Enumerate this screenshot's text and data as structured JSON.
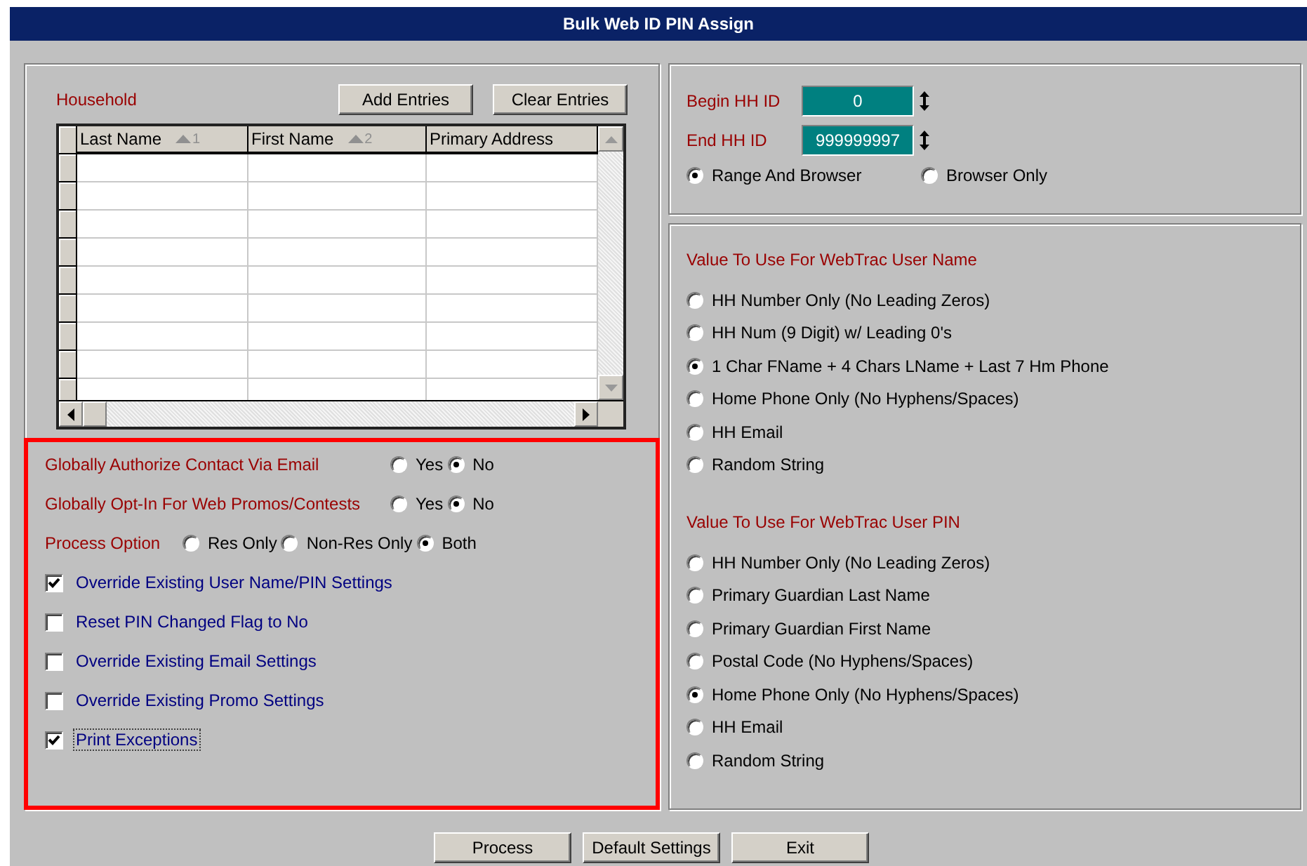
{
  "window": {
    "title": "Bulk Web ID PIN Assign"
  },
  "household": {
    "label": "Household",
    "buttons": [
      "Add Entries",
      "Clear Entries"
    ],
    "columns": [
      {
        "label": "Last Name",
        "sort_order": "1"
      },
      {
        "label": "First Name",
        "sort_order": "2"
      },
      {
        "label": "Primary Address"
      }
    ]
  },
  "options": [
    {
      "kind": "radio_group",
      "label": "Globally Authorize Contact Via Email",
      "choices": [
        {
          "label": "Yes",
          "selected": false
        },
        {
          "label": "No",
          "selected": true
        }
      ]
    },
    {
      "kind": "radio_group",
      "label": "Globally Opt-In For Web Promos/Contests",
      "choices": [
        {
          "label": "Yes",
          "selected": false
        },
        {
          "label": "No",
          "selected": true
        }
      ]
    },
    {
      "kind": "radio_group",
      "label": "Process Option",
      "choices": [
        {
          "label": "Res Only",
          "selected": false
        },
        {
          "label": "Non-Res Only",
          "selected": false
        },
        {
          "label": "Both",
          "selected": true
        }
      ]
    },
    {
      "kind": "checkbox",
      "label": "Override Existing User Name/PIN Settings",
      "checked": true,
      "focused": false
    },
    {
      "kind": "checkbox",
      "label": "Reset PIN Changed Flag to No",
      "checked": false,
      "focused": false
    },
    {
      "kind": "checkbox",
      "label": "Override Existing Email Settings",
      "checked": false,
      "focused": false
    },
    {
      "kind": "checkbox",
      "label": "Override Existing Promo Settings",
      "checked": false,
      "focused": false
    },
    {
      "kind": "checkbox",
      "label": "Print Exceptions",
      "checked": true,
      "focused": true
    }
  ],
  "range": {
    "fields": [
      {
        "label": "Begin HH ID",
        "value": "0"
      },
      {
        "label": "End HH ID",
        "value": "999999997"
      }
    ],
    "modes": [
      {
        "label": "Range And Browser",
        "selected": true
      },
      {
        "label": "Browser Only",
        "selected": false
      }
    ]
  },
  "user_name": {
    "heading": "Value To Use For WebTrac User Name",
    "choices": [
      {
        "label": "HH Number Only (No Leading Zeros)",
        "selected": false
      },
      {
        "label": "HH Num (9 Digit) w/ Leading 0's",
        "selected": false
      },
      {
        "label": "1 Char FName + 4 Chars LName + Last 7 Hm Phone",
        "selected": true
      },
      {
        "label": "Home Phone Only (No Hyphens/Spaces)",
        "selected": false
      },
      {
        "label": "HH Email",
        "selected": false
      },
      {
        "label": "Random String",
        "selected": false
      }
    ]
  },
  "user_pin": {
    "heading": "Value To Use For WebTrac User PIN",
    "choices": [
      {
        "label": "HH Number Only (No Leading Zeros)",
        "selected": false
      },
      {
        "label": "Primary Guardian Last Name",
        "selected": false
      },
      {
        "label": "Primary Guardian First Name",
        "selected": false
      },
      {
        "label": "Postal Code (No Hyphens/Spaces)",
        "selected": false
      },
      {
        "label": "Home Phone Only (No Hyphens/Spaces)",
        "selected": true
      },
      {
        "label": "HH Email",
        "selected": false
      },
      {
        "label": "Random String",
        "selected": false
      }
    ]
  },
  "buttons": [
    "Process",
    "Default Settings",
    "Exit"
  ]
}
